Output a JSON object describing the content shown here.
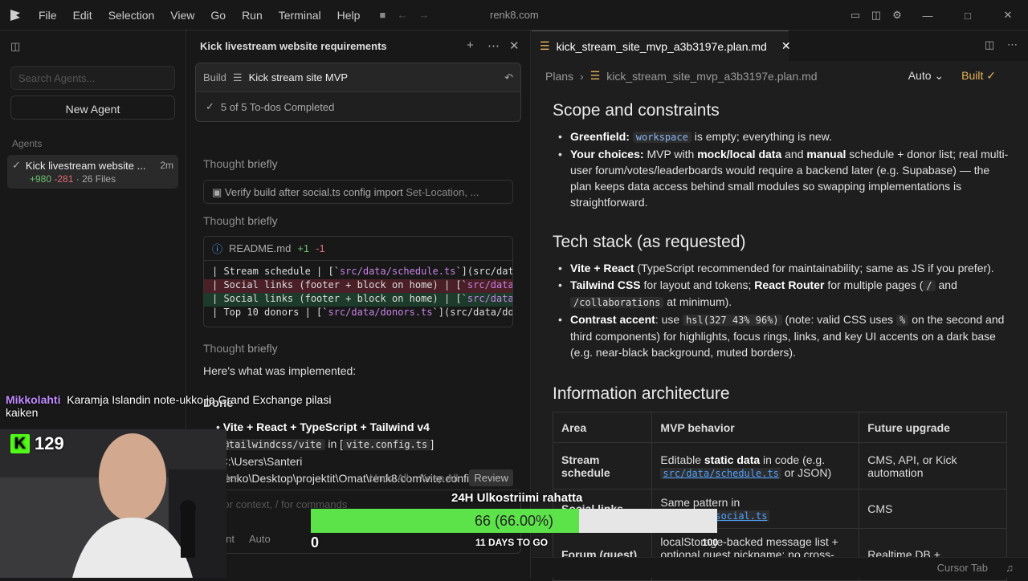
{
  "titlebar": {
    "menu": [
      "File",
      "Edit",
      "Selection",
      "View",
      "Go",
      "Run",
      "Terminal",
      "Help"
    ],
    "window_title": "renk8.com"
  },
  "sidebar": {
    "search_placeholder": "Search Agents...",
    "new_agent": "New Agent",
    "section": "Agents",
    "agent": {
      "title": "Kick livestream website ...",
      "age": "2m",
      "added": "+980",
      "removed": "-281",
      "files": "· 26 Files"
    }
  },
  "chat": {
    "title": "Kick livestream website requirements",
    "build_label": "Build",
    "build_name": "Kick stream site MVP",
    "todos": "5 of 5 To-dos Completed",
    "thought_label": "Thought",
    "thought_time": "briefly",
    "command": "Verify build after social.ts config import",
    "command_suffix": "Set-Location, ...",
    "readme": {
      "name": "README.md",
      "add": "+1",
      "del": "-1"
    },
    "code": [
      {
        "pre": "| Stream schedule | [`",
        "link": "src/data/schedule.ts",
        "post": "`](src/dat"
      },
      {
        "pre": "| Social links (footer + block on home) | [`",
        "link": "src/data",
        "post": ""
      },
      {
        "pre": "| Social links (footer + block on home) | [`",
        "link": "src/data",
        "post": ""
      },
      {
        "pre": "| Top 10 donors | [`",
        "link": "src/data/donors.ts",
        "post": "`](src/data/do"
      }
    ],
    "implemented": "Here's what was implemented:",
    "done": "Done",
    "bullet_bold": "Vite + React + TypeScript + Tailwind v4",
    "bullet_code": "@tailwindcss/vite",
    "bullet_in": "in",
    "bullet_code2": "vite.config.ts",
    "bullet_path": "(C:\\Users\\Santeri Renko\\Desktop\\projektit\\Omat\\renk8.com\\vite.config.ts).",
    "files_count": "26 Files",
    "undo_all": "Undo All",
    "keep_all": "Keep All",
    "review": "Review",
    "composer_placeholder": "@ for context, / for commands",
    "mode": "Agent",
    "model": "Auto"
  },
  "editor": {
    "tab": "kick_stream_site_mvp_a3b3197e.plan.md",
    "crumb_root": "Plans",
    "crumb_file": "kick_stream_site_mvp_a3b3197e.plan.md",
    "mode": "Auto",
    "status": "Built",
    "sec1": "Scope and constraints",
    "s1b1_bold": "Greenfield:",
    "s1b1_code": "workspace",
    "s1b1_rest": "is empty; everything is new.",
    "s1b2_bold": "Your choices:",
    "s1b2_a": "MVP with",
    "s1b2_b": "mock/local data",
    "s1b2_c": "and",
    "s1b2_d": "manual",
    "s1b2_e": "schedule + donor list; real multi-user forum/votes/leaderboards would require a backend later (e.g. Supabase) — the plan keeps data access behind small modules so swapping implementations is straightforward.",
    "sec2": "Tech stack (as requested)",
    "s2b1_bold": "Vite + React",
    "s2b1_rest": "(TypeScript recommended for maintainability; same as JS if you prefer).",
    "s2b2_bold": "Tailwind CSS",
    "s2b2_a": "for layout and tokens;",
    "s2b2_bold2": "React Router",
    "s2b2_b": "for multiple pages (",
    "s2b2_code1": "/",
    "s2b2_c": "and",
    "s2b2_code2": "/collaborations",
    "s2b2_d": "at minimum).",
    "s2b3_bold": "Contrast accent",
    "s2b3_a": ": use",
    "s2b3_code": "hsl(327 43% 96%)",
    "s2b3_b": "(note: valid CSS uses",
    "s2b3_code2": "%",
    "s2b3_c": "on the second and third components) for highlights, focus rings, links, and key UI accents on a dark base (e.g. near-black background, muted borders).",
    "sec3": "Information architecture",
    "table": {
      "headers": [
        "Area",
        "MVP behavior",
        "Future upgrade"
      ],
      "r1": {
        "area": "Stream schedule",
        "a": "Editable",
        "b": "static data",
        "c": "in code (e.g.",
        "link": "src/data/schedule.ts",
        "d": "or JSON)",
        "future": "CMS, API, or Kick automation"
      },
      "r2": {
        "area": "Social links",
        "a": "Same pattern in",
        "link": "src/data/social.ts",
        "future": "CMS"
      },
      "r3": {
        "area": "Forum (guest)",
        "a": "localStorage-backed message list +",
        "b": "optional guest nickname; no cross-device",
        "future": "Realtime DB +"
      }
    }
  },
  "statusbar": {
    "cursor_tab": "Cursor Tab"
  },
  "overlay": {
    "chat_user": "Mikkolahti",
    "chat_msg": "Karamja Islandin note-ukko ja Grand Exchange pilasi kaiken",
    "viewers": "129",
    "goal_title": "24H Ulkostriimi rahatta",
    "goal_text": "66 (66.00%)",
    "goal_progress": 0.66,
    "goal_min": "0",
    "goal_days": "11 DAYS TO GO",
    "goal_max": "100"
  },
  "colors": {
    "accent_green": "#5de34a",
    "kick_green": "#53fc18",
    "built": "#e5b45a"
  }
}
